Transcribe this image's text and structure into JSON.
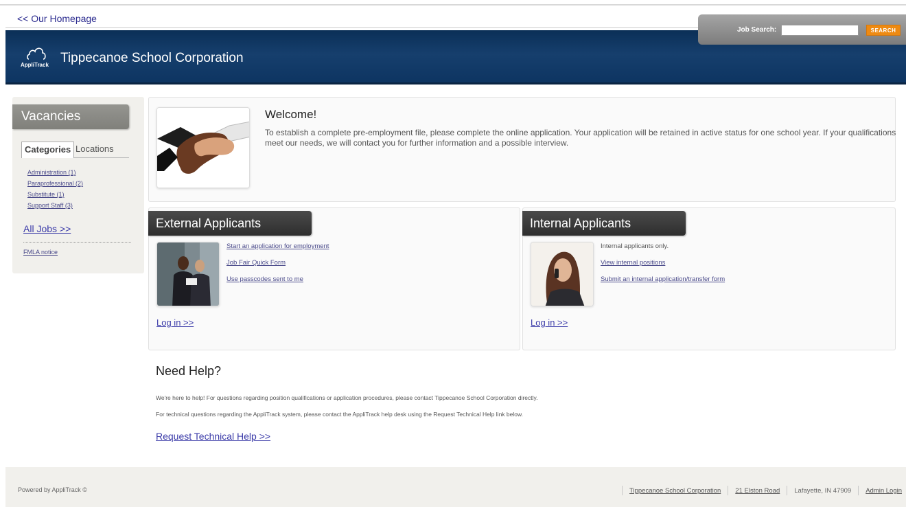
{
  "nav": {
    "home_link": "<< Our Homepage"
  },
  "header": {
    "logo_text": "AppliTrack",
    "org_name": "Tippecanoe School Corporation"
  },
  "search": {
    "label": "Job Search:",
    "value": "",
    "button": "SEARCH"
  },
  "sidebar": {
    "title": "Vacancies",
    "tabs": [
      "Categories",
      "Locations"
    ],
    "categories": [
      "Administration (1)",
      "Paraprofessional (2)",
      "Substitute (1)",
      "Support Staff (3)"
    ],
    "all_jobs": "All Jobs >>",
    "fmla": "FMLA notice"
  },
  "welcome": {
    "title": "Welcome!",
    "text": "To establish a complete pre-employment file, please complete the online application. Your application will be retained in active status for one school year. If your qualifications meet our needs, we will contact you for further information and a possible interview."
  },
  "external": {
    "title": "External Applicants",
    "links": [
      "Start an application for employment",
      "Job Fair Quick Form",
      "Use passcodes sent to me"
    ],
    "login": "Log in >>"
  },
  "internal": {
    "title": "Internal Applicants",
    "note": "Internal applicants only.",
    "links": [
      "View internal positions",
      "Submit an internal application/transfer form"
    ],
    "login": "Log in >>"
  },
  "help": {
    "title": "Need Help?",
    "p1": "We're here to help! For questions regarding position qualifications or application procedures, please contact Tippecanoe School Corporation directly.",
    "p2": "For technical questions regarding the AppliTrack system, please contact the AppliTrack help desk using the Request Technical Help link below.",
    "link": "Request Technical Help >>"
  },
  "footer": {
    "powered": "Powered by AppliTrack ©",
    "org_link": "Tippecanoe School Corporation",
    "address_link": "21 Elston Road",
    "city": "Lafayette, IN 47909",
    "admin_link": "Admin Login"
  },
  "colors": {
    "header_blue": "#123a66",
    "search_orange": "#ee8a12",
    "link": "#3a3aa8"
  },
  "icons": {
    "logo": "cloud-icon"
  }
}
